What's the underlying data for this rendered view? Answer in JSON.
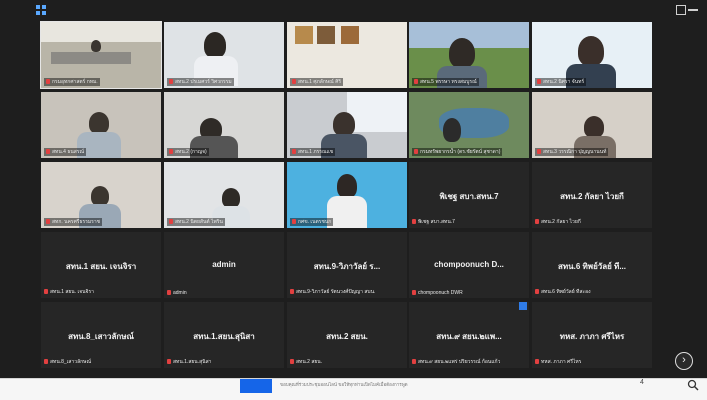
{
  "toolbar": {
    "layout_icon": "grid-icon",
    "window_icon": "square-icon"
  },
  "tiles": [
    {
      "id": "t1",
      "label": "กรมอุทกศาสตร์ กทม.",
      "kind": "video",
      "scene": "office-room"
    },
    {
      "id": "t2",
      "label": "สทน.2 ปรเมศวร์ วิศวกรรม",
      "kind": "video",
      "scene": "man-office"
    },
    {
      "id": "t3",
      "label": "สทน.1 ศุภลักษณ์ ศิริ",
      "kind": "video",
      "scene": "wall-pictures"
    },
    {
      "id": "t4",
      "label": "สทน.5 พรรษา ทรงสมบูรณ์",
      "kind": "video",
      "scene": "man-landscape"
    },
    {
      "id": "t5",
      "label": "สทน.2 นิศรา จันทร์",
      "kind": "video",
      "scene": "woman-logo"
    },
    {
      "id": "t6",
      "label": "สทน.4 ธนสรณ์",
      "kind": "video",
      "scene": "man-mask"
    },
    {
      "id": "t7",
      "label": "สทน.2 (กาญจ)",
      "kind": "video",
      "scene": "man-desk"
    },
    {
      "id": "t8",
      "label": "สทน.1 ภรรณแข",
      "kind": "video",
      "scene": "woman-window"
    },
    {
      "id": "t9",
      "label": "กรมทรัพยากรน้ำ (ดร.ชัยรัตน์ สุชาดา)",
      "kind": "video",
      "scene": "dam-aerial"
    },
    {
      "id": "t10",
      "label": "สทน.3 วรรณิกา ปุญญนานนท์",
      "kind": "video",
      "scene": "woman-room"
    },
    {
      "id": "t11",
      "label": "สทก. นครศรีธรรมราช",
      "kind": "video",
      "scene": "man-mask2"
    },
    {
      "id": "t12",
      "label": "สทน.2 นิตยสันต์ ไพริน",
      "kind": "video",
      "scene": "man-office2"
    },
    {
      "id": "t13",
      "label": "กศข. เนตรชนก",
      "kind": "video",
      "scene": "woman-blue"
    },
    {
      "id": "t14",
      "name": "พิเชฐ สบา.สทน.7",
      "label": "พิเชฐ สบา.สทน.7",
      "kind": "name"
    },
    {
      "id": "t15",
      "name": "สทน.2 กัลยา ไวยกี",
      "label": "สทน.2 กัลยา ไวยกี",
      "kind": "name"
    },
    {
      "id": "t16",
      "name": "สทน.1 สยน. เจนจิรา",
      "label": "สทน.1 สยน. เจนจิรา",
      "kind": "name"
    },
    {
      "id": "t17",
      "name": "admin",
      "label": "admin",
      "kind": "name"
    },
    {
      "id": "t18",
      "name": "สทน.9-วิภาวัลย์ ร...",
      "label": "สทน.9-วิภาวัลย์ รัตนวงศ์ปัญญา สบน.",
      "kind": "name"
    },
    {
      "id": "t19",
      "name": "chompoonuch D...",
      "label": "chompoonuch DWR",
      "kind": "name"
    },
    {
      "id": "t20",
      "name": "สทน.6 ทิพย์วัลย์ ที...",
      "label": "สทน.6 ทิพย์วัลย์ ทีสะอง",
      "kind": "name"
    },
    {
      "id": "t21",
      "name": "สทน.8_เสาวลักษณ์",
      "label": "สทน.8_เสาวลักษณ์",
      "kind": "name"
    },
    {
      "id": "t22",
      "name": "สทน.1.สยน.สุนิสา",
      "label": "สทน.1.สยน.สุนิสา",
      "kind": "name"
    },
    {
      "id": "t23",
      "name": "สทน.2 สยน.",
      "label": "สทน.2 สยน.",
      "kind": "name"
    },
    {
      "id": "t24",
      "name": "สทน.๙ สยน.๒แพ...",
      "label": "สทน.๙ สยน.๒แพร่ ปริยวรรณ์ ก้อนแก้ว",
      "kind": "name"
    },
    {
      "id": "t25",
      "name": "ทหส. ภาภา ศรีไหร",
      "label": "ทหส. ภาภา ศรีไหร",
      "kind": "name"
    }
  ],
  "scroll_button": {
    "glyph": "›",
    "icon": "chevron-right-icon"
  },
  "taskbar": {
    "note": "ขอบคุณที่ร่วมประชุมออนไลน์ ขอให้ทุกท่านเปิดไมค์เมื่อต้องการพูด",
    "page_number": "4"
  },
  "colors": {
    "background": "#1e1e1e",
    "tile": "#262626",
    "accent": "#2f7ce8",
    "mic_off": "#e24040"
  }
}
